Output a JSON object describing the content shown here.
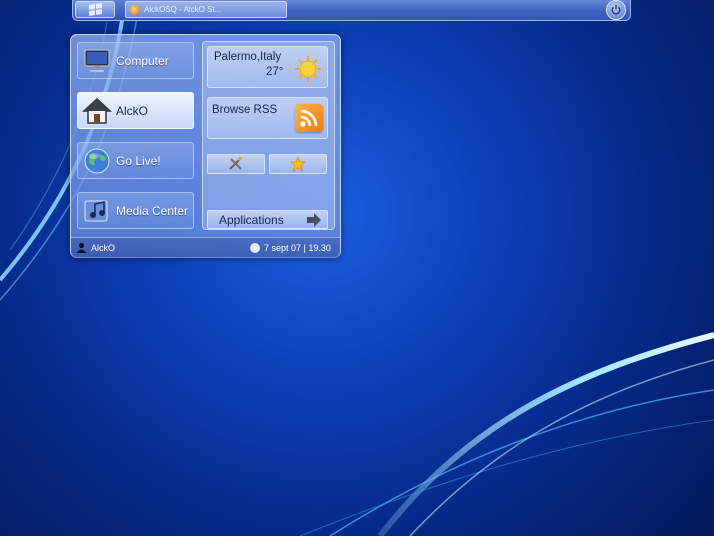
{
  "taskbar": {
    "start_icon": "windows-logo-icon",
    "task_label": "AlckOSQ - AlckO St...",
    "power_icon": "power-icon"
  },
  "start_menu": {
    "left_items": [
      {
        "label": "Computer",
        "icon": "computer-icon"
      },
      {
        "label": "AlckO",
        "icon": "home-icon"
      },
      {
        "label": "Go Live!",
        "icon": "globe-icon"
      },
      {
        "label": "Media Center",
        "icon": "media-center-icon"
      }
    ],
    "weather": {
      "city": "Palermo,Italy",
      "temp": "27°",
      "icon": "sun-icon"
    },
    "rss": {
      "label": "Browse RSS",
      "icon": "rss-icon"
    },
    "quick_buttons": [
      {
        "icon": "tools-icon"
      },
      {
        "icon": "star-icon"
      }
    ],
    "applications_label": "Applications",
    "footer": {
      "username": "AlckO",
      "datetime": "7 sept 07 | 19.30"
    }
  },
  "colors": {
    "desktop_blue": "#0d3fb8",
    "streak_cyan": "#7fd9ff"
  }
}
